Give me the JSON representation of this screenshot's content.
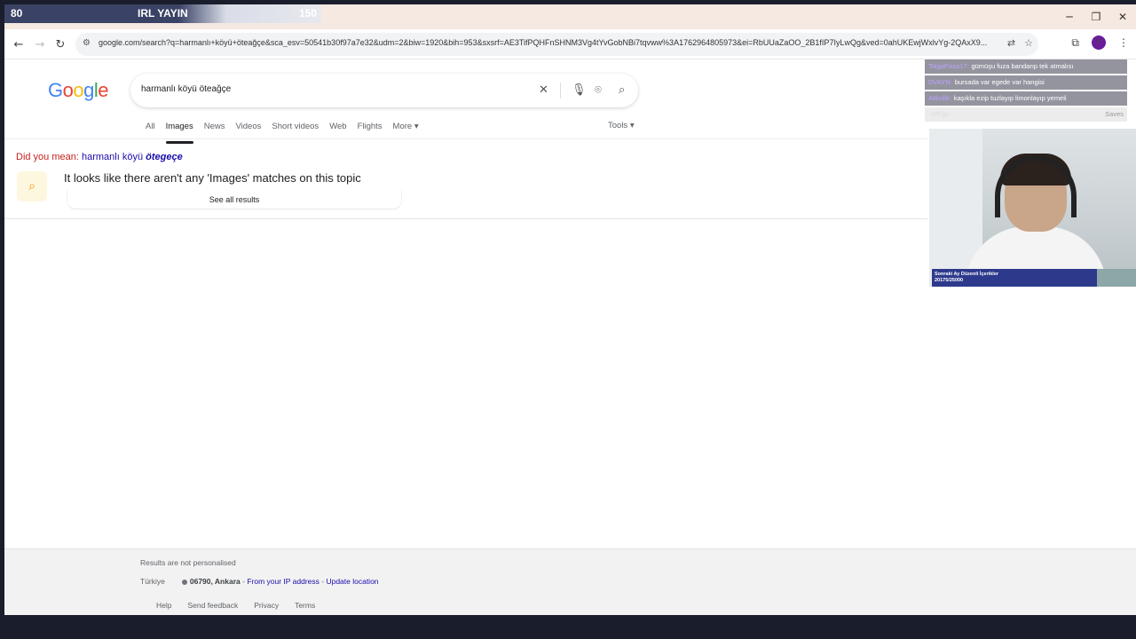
{
  "stream_bar": {
    "left_value": "80",
    "title": "IRL YAYIN",
    "right_value": "150"
  },
  "browser": {
    "url": "google.com/search?q=harmanlı+köyü+öteağçe&sca_esv=50541b30f97a7e32&udm=2&biw=1920&bih=953&sxsrf=AE3TifPQHFnSHNM3Vg4tYvGobNBi7tqvww%3A1762964805973&ei=RbUUaZaOO_2B1fIP7IyLwQg&ved=0ahUKEwjWxlvYg-2QAxX9..."
  },
  "google": {
    "search_query": "harmanlı köyü öteağçe",
    "tabs": [
      {
        "label": "All",
        "active": false
      },
      {
        "label": "Images",
        "active": true
      },
      {
        "label": "News",
        "active": false
      },
      {
        "label": "Videos",
        "active": false
      },
      {
        "label": "Short videos",
        "active": false
      },
      {
        "label": "Web",
        "active": false
      },
      {
        "label": "Flights",
        "active": false
      },
      {
        "label": "More",
        "active": false
      }
    ],
    "tools_label": "Tools",
    "did_you_mean_prefix": "Did you mean:",
    "did_you_mean_plain": "harmanlı köyü",
    "did_you_mean_corrected": "ötegeçe",
    "no_results_message": "It looks like there aren't any 'Images' matches on this topic",
    "see_all_label": "See all results"
  },
  "footer": {
    "personalised_note": "Results are not personalised",
    "country": "Türkiye",
    "location": "06790, Ankara",
    "location_source": "From your IP address",
    "update_location": "Update location",
    "links": [
      "Help",
      "Send feedback",
      "Privacy",
      "Terms"
    ]
  },
  "chat": [
    {
      "user": "TolgaPasa17:",
      "message": "gümüşu fuza bandarıp tek atmalısı"
    },
    {
      "user": "DVAYN:",
      "message": "bursada var egede var hangisi"
    },
    {
      "user": "Altkolik:",
      "message": "kaşıkla ezip tuzlayıp limonlayıp yemeli"
    },
    {
      "user": "",
      "message": "offf go"
    }
  ],
  "saves_label": "Saves",
  "webcam": {
    "label_line1": "Sonraki Ay Düzenli İçerikler",
    "label_line2": "20175/25000"
  },
  "colors": {
    "accent_blue": "#1a0dab",
    "dym_red": "#c5221f",
    "stream_bar": "#3a4365"
  }
}
